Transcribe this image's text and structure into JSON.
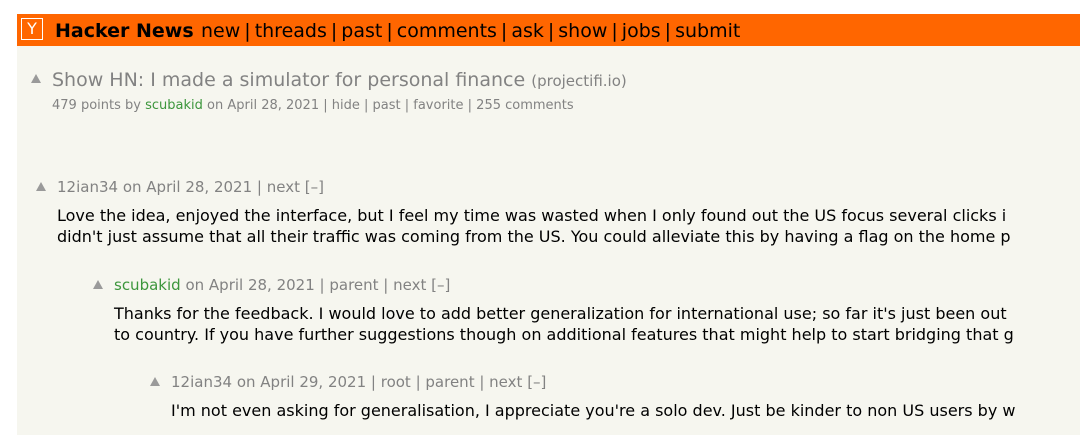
{
  "header": {
    "logo": "Y",
    "site_name": "Hacker News",
    "nav": [
      "new",
      "threads",
      "past",
      "comments",
      "ask",
      "show",
      "jobs",
      "submit"
    ]
  },
  "story": {
    "title": "Show HN: I made a simulator for personal finance",
    "domain": "(projectifi.io)",
    "points": "479 points",
    "by": "by",
    "user": "scubakid",
    "date": "on April 28, 2021",
    "hide": "hide",
    "past": "past",
    "favorite": "favorite",
    "comments": "255 comments"
  },
  "comments": [
    {
      "user": "12ian34",
      "date": "on April 28, 2021",
      "links": [
        "next"
      ],
      "toggle": "[–]",
      "lines": [
        "Love the idea, enjoyed the interface, but I feel my time was wasted when I only found out the US focus several clicks i",
        "didn't just assume that all their traffic was coming from the US. You could alleviate this by having a flag on the home p"
      ]
    },
    {
      "user": "scubakid",
      "date": "on April 28, 2021",
      "links": [
        "parent",
        "next"
      ],
      "toggle": "[–]",
      "lines": [
        "Thanks for the feedback. I would love to add better generalization for international use; so far it's just been out",
        "to country. If you have further suggestions though on additional features that might help to start bridging that g"
      ]
    },
    {
      "user": "12ian34",
      "date": "on April 29, 2021",
      "links": [
        "root",
        "parent",
        "next"
      ],
      "toggle": "[–]",
      "lines": [
        "I'm not even asking for generalisation, I appreciate you're a solo dev. Just be kinder to non US users by w"
      ]
    }
  ],
  "colors": {
    "topbar": "#ff6600",
    "background": "#f6f6ef",
    "meta": "#828282",
    "user": "#3c963c"
  }
}
